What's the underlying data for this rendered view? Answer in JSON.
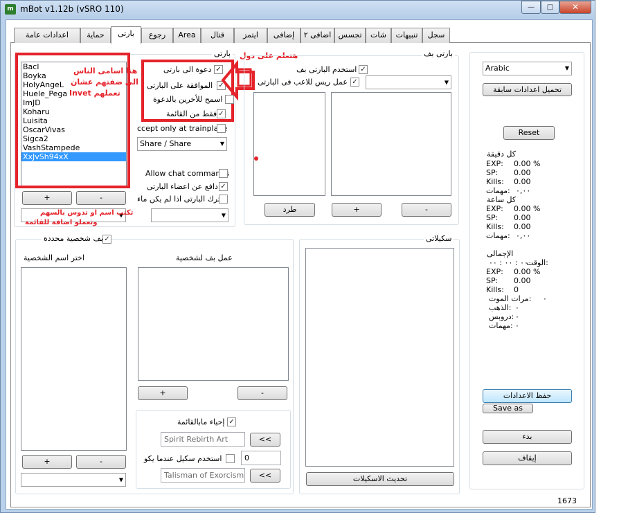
{
  "window": {
    "title": "mBot v1.12b (vSRO 110)",
    "app_icon": "m",
    "min": "—",
    "max": "□",
    "close": "✕"
  },
  "tabs": [
    {
      "label": "سجل"
    },
    {
      "label": "تنبيهات"
    },
    {
      "label": "شات"
    },
    {
      "label": "تجسس"
    },
    {
      "label": "اضافى ٢"
    },
    {
      "label": "إضافى"
    },
    {
      "label": "ايتمز"
    },
    {
      "label": "قتال"
    },
    {
      "label": "Area"
    },
    {
      "label": "رجوع"
    },
    {
      "label": "بارتى"
    },
    {
      "label": "حماية"
    },
    {
      "label": "اعدادات عامة"
    }
  ],
  "party": {
    "group_label": "بارتى",
    "members": [
      "Bacl",
      "Boyka",
      "HolyAngeL",
      "Huele_Pega",
      "ImJD",
      "Koharu",
      "Luisita",
      "OscarVivas",
      "Sigca2",
      "VashStampede",
      "XxJvSh94xX"
    ],
    "selected_member": "XxJvSh94xX",
    "add_label": "+",
    "remove_label": "-",
    "invite_label": "دعوة الى بارتى",
    "accept_label": "الموافقة على البارتى",
    "allow_others_label": "اسمح للأخرين بالدعوة",
    "only_list_label": "فقط من القائمة",
    "trainplace_label": "ccept only at trainplace",
    "share_value": "Share / Share",
    "allow_chat_label": "Allow chat commands",
    "defend_label": "دافع عن اعضاء البارتى",
    "leave_label": "اترك البارتى اذا لم يكن ماء",
    "annotation_names": [
      "هنا اسامى الناس",
      "الى ضفتهم عشان",
      "Invet تعملهم"
    ],
    "annotation_type": [
      "تكتب اسم او تدوس بالسهم",
      "وتعملو اضافة للقائمة"
    ],
    "annotation_check": "هتعلم على دول"
  },
  "party_buff": {
    "group_label": "بارتى بف",
    "use_label": "استخدم البارتى بف",
    "res_label": "عمل ريس للاعب فى البارتى",
    "kick_label": "طرد",
    "add_label": "+",
    "remove_label": "-"
  },
  "char_buff": {
    "group_label": "بف شخصية محددة",
    "choose_label": "اختر اسم الشخصية",
    "make_label": "عمل بف لشخصية",
    "add_label": "+",
    "remove_label": "-",
    "revive_label": "إحياء مابالقائمة",
    "revive_skill": "Spirit Rebirth Art",
    "use_skill_label": "استخدم سكيل عندما يكو",
    "use_skill_value": "0",
    "talisman": "Talisman of Exorcism",
    "arrows": "<<"
  },
  "skills": {
    "group_label": "سكيلاتى",
    "update_label": "تحديث الاسكيلات"
  },
  "right": {
    "language": "Arabic",
    "load_prev": "تحميل اعدادات سابقة",
    "reset": "Reset",
    "per_minute": {
      "title": "كل دقيقة",
      "exp": "EXP:",
      "exp_v": "0.00 %",
      "sp": "SP:",
      "sp_v": "0.00",
      "kills": "Kills:",
      "kills_v": "0.00",
      "tasks": "مهمات:",
      "tasks_v": "٠,٠٠"
    },
    "per_hour": {
      "title": "كل ساعة",
      "exp": "EXP:",
      "exp_v": "0.00 %",
      "sp": "SP:",
      "sp_v": "0.00",
      "kills": "Kills:",
      "kills_v": "0.00",
      "tasks": "مهمات:",
      "tasks_v": "٠,٠٠"
    },
    "total": {
      "title": "الإجمالى",
      "time_label": "الوقت:",
      "time_v": "٠٠ : ٠٠ : ٠٠",
      "exp": "EXP:",
      "exp_v": "0.00 %",
      "sp": "SP:",
      "sp_v": "0.00",
      "kills": "Kills:",
      "kills_v": "0",
      "deaths": "مرات الموت:",
      "deaths_v": "٠",
      "gold": "الذهب:",
      "gold_v": "٠",
      "drops": "دروبس:",
      "drops_v": "٠",
      "tasks": "مهمات:",
      "tasks_v": "٠"
    },
    "save_settings": "حفظ الاعدادات",
    "save_as": "Save as",
    "start": "بدء",
    "stop": "إيقاف"
  },
  "status": {
    "value": "1673"
  },
  "colors": {
    "annotation": "#e5232b",
    "selection": "#3399ff",
    "frame": "#b9d1ea"
  }
}
